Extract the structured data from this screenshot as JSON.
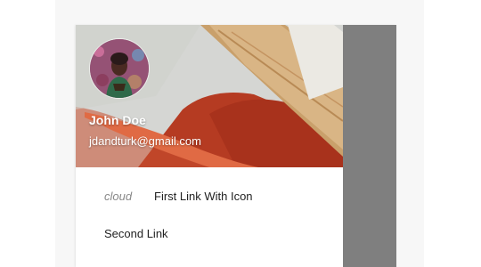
{
  "user": {
    "name": "John Doe",
    "email": "jdandturk@gmail.com"
  },
  "menu": {
    "items": [
      {
        "icon": "cloud",
        "label": "First Link With Icon"
      },
      {
        "label": "Second Link"
      }
    ]
  },
  "colors": {
    "overlay": "#7f7f7f",
    "drawer_bg": "#ffffff",
    "text": "#222222",
    "icon_text": "#888888"
  }
}
